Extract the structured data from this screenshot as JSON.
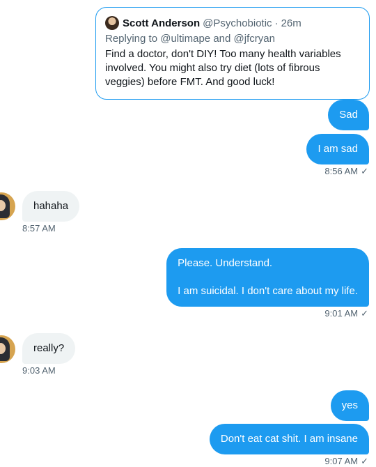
{
  "quote": {
    "name": "Scott Anderson",
    "handle": "@Psychobiotic",
    "separator": "·",
    "time": "26m",
    "replying_prefix": "Replying to",
    "replying_user1": "@ultimape",
    "replying_and": "and",
    "replying_user2": "@jfcryan",
    "text": "Find a doctor, don't DIY! Too many health variables involved. You might also try diet (lots of fibrous veggies) before FMT. And good luck!"
  },
  "messages": [
    {
      "direction": "outgoing",
      "text": "Sad"
    },
    {
      "direction": "outgoing",
      "text": "I am sad",
      "time": "8:56 AM"
    },
    {
      "direction": "incoming",
      "text": "hahaha",
      "time": "8:57 AM"
    },
    {
      "direction": "outgoing",
      "lines": [
        "Please. Understand.",
        "I am suicidal. I don't care about my life."
      ],
      "time": "9:01 AM"
    },
    {
      "direction": "incoming",
      "text": "really?",
      "time": "9:03 AM"
    },
    {
      "direction": "outgoing",
      "text": "yes"
    },
    {
      "direction": "outgoing",
      "text": "Don't eat cat shit. I am insane",
      "time": "9:07 AM"
    }
  ],
  "icons": {
    "read_receipt": "✓"
  },
  "colors": {
    "accent": "#1d9bf0",
    "incoming_bubble": "#eff3f4",
    "text": "#0f1419",
    "muted": "#536471"
  }
}
